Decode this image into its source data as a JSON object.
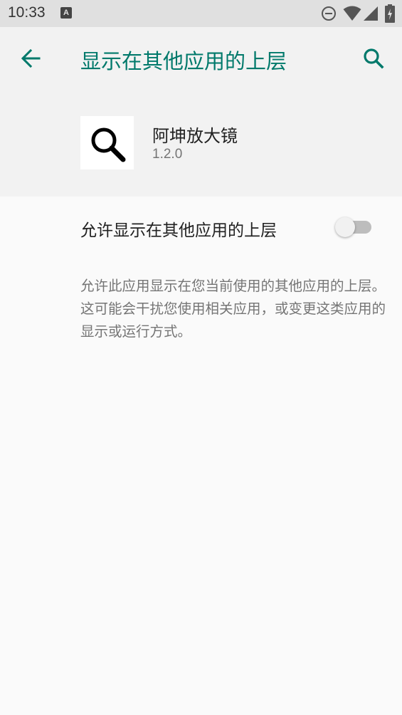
{
  "status_bar": {
    "time": "10:33",
    "notification_icon_letter": "A",
    "icons": [
      "do-not-disturb-icon",
      "wifi-icon",
      "signal-icon",
      "battery-charging-icon"
    ]
  },
  "app_bar": {
    "title": "显示在其他应用的上层",
    "back_icon": "arrow-back-icon",
    "search_icon": "search-icon",
    "accent_color": "#00796b"
  },
  "app_info": {
    "name": "阿坤放大镜",
    "version": "1.2.0",
    "icon": "magnifier-icon"
  },
  "setting": {
    "label": "允许显示在其他应用的上层",
    "enabled": false
  },
  "description": "允许此应用显示在您当前使用的其他应用的上层。这可能会干扰您使用相关应用，或变更这类应用的显示或运行方式。"
}
